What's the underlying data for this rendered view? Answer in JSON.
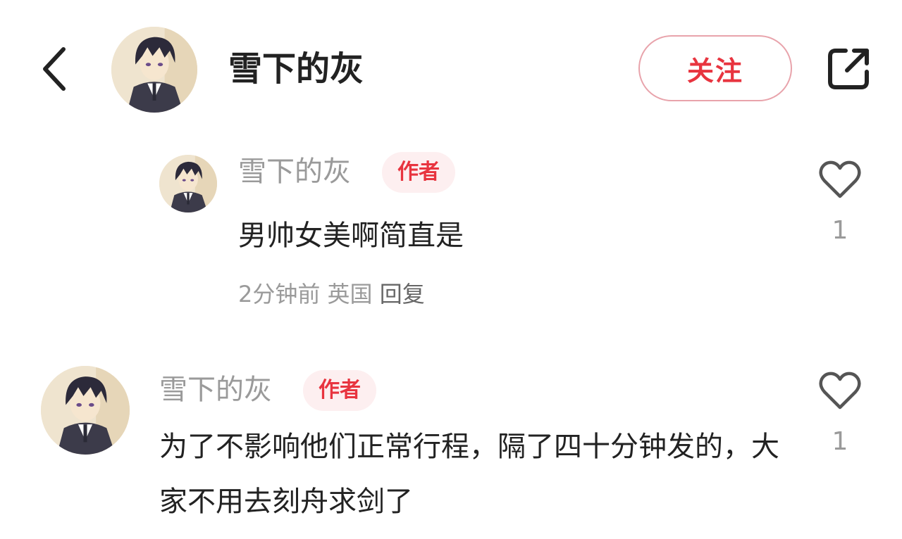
{
  "header": {
    "back_icon": "chevron-left-icon",
    "title": "雪下的灰",
    "follow_label": "关注",
    "share_icon": "share-external-icon"
  },
  "comments": [
    {
      "type": "reply",
      "author": "雪下的灰",
      "badge": "作者",
      "text": "男帅女美啊简直是",
      "meta": {
        "time": "2分钟前",
        "location": "英国",
        "reply_label": "回复"
      },
      "like_icon": "heart-outline-icon",
      "likes": "1"
    },
    {
      "type": "top-level",
      "author": "雪下的灰",
      "badge": "作者",
      "text": "为了不影响他们正常行程，隔了四十分钟发的，大家不用去刻舟求剑了",
      "like_icon": "heart-outline-icon",
      "likes": "1"
    }
  ],
  "colors": {
    "accent": "#e8343f",
    "accent_border": "#e8a3ab",
    "badge_bg": "#fdeff0",
    "muted_text": "#9a9a9a",
    "primary_text": "#222222"
  }
}
